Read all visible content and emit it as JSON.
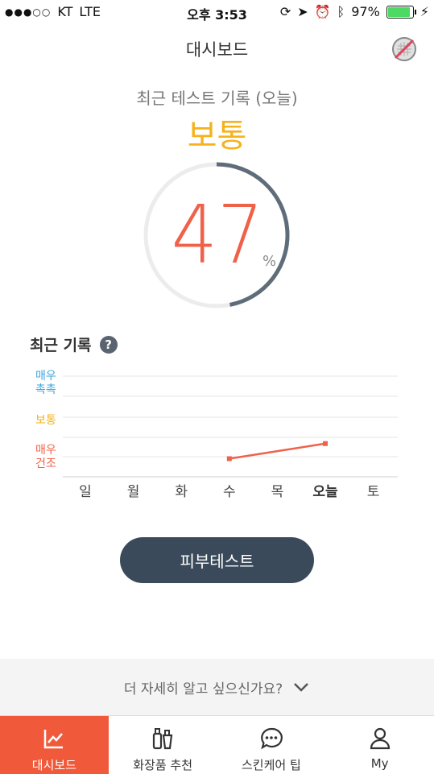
{
  "statusbar": {
    "carrier": "KT",
    "network": "LTE",
    "time": "오후 3:53",
    "battery": "97%",
    "battery_level": 0.97
  },
  "header": {
    "title": "대시보드",
    "icon": "no-powder-icon"
  },
  "summary": {
    "label": "최근 테스트 기록 (오늘)",
    "status": "보통",
    "value": "47",
    "unit": "%",
    "gauge_fraction": 0.47
  },
  "history": {
    "title": "최근 기록",
    "help": "?"
  },
  "chart_data": {
    "type": "line",
    "categories": [
      "일",
      "월",
      "화",
      "수",
      "목",
      "오늘",
      "토"
    ],
    "y_labels": [
      "매우\n촉촉",
      "보통",
      "매우\n건조"
    ],
    "points": [
      {
        "x": "수",
        "y": 0.18
      },
      {
        "x": "오늘",
        "y": 0.33
      }
    ],
    "colors": {
      "line": "#f0614a",
      "moist": "#3aa6e0",
      "normal": "#f5b21b",
      "dry": "#f0614a"
    }
  },
  "y_labels": {
    "moist": "매우\n촉촉",
    "normal": "보통",
    "dry": "매우\n건조"
  },
  "button": {
    "label": "피부테스트"
  },
  "more": {
    "label": "더 자세히 알고 싶으신가요?"
  },
  "tabs": [
    {
      "label": "대시보드",
      "icon": "chart-icon"
    },
    {
      "label": "화장품 추천",
      "icon": "cosmetics-icon"
    },
    {
      "label": "스킨케어 팁",
      "icon": "chat-icon"
    },
    {
      "label": "My",
      "icon": "person-icon"
    }
  ]
}
